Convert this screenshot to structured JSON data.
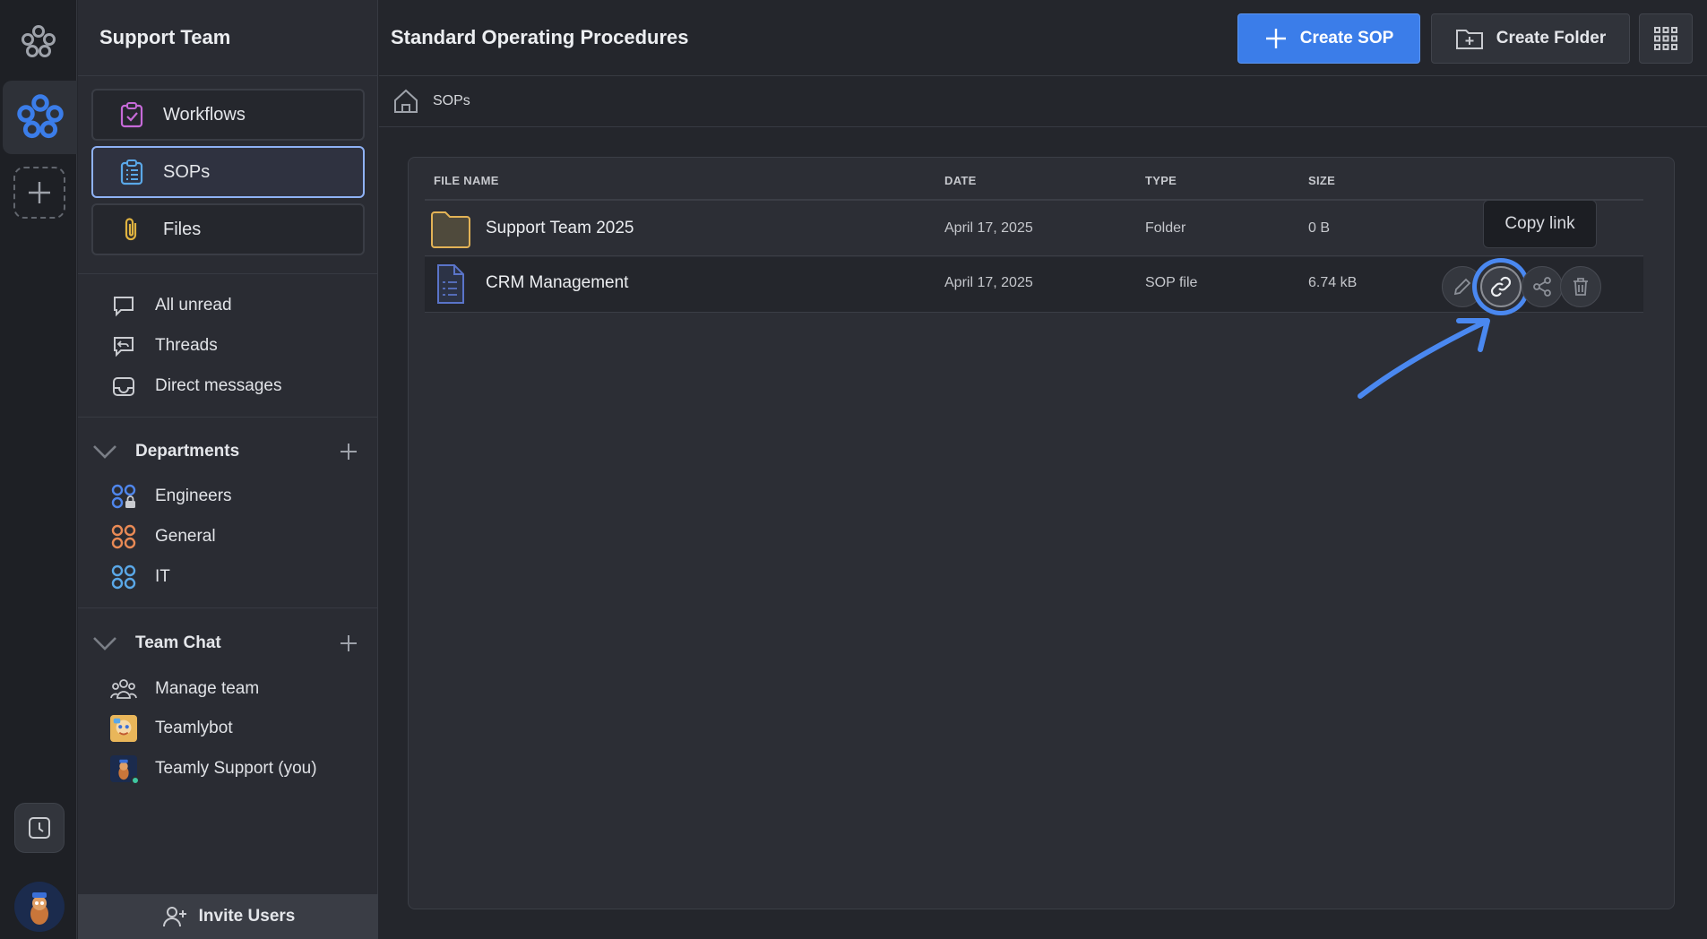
{
  "sidebar": {
    "title": "Support Team",
    "nav": [
      {
        "label": "Workflows",
        "icon": "workflow-clipboard-icon"
      },
      {
        "label": "SOPs",
        "icon": "sop-list-icon"
      },
      {
        "label": "Files",
        "icon": "paperclip-icon"
      }
    ],
    "inbox": [
      {
        "label": "All unread",
        "icon": "chat-bubble-icon"
      },
      {
        "label": "Threads",
        "icon": "thread-reply-icon"
      },
      {
        "label": "Direct messages",
        "icon": "inbox-tray-icon"
      }
    ],
    "departments": {
      "title": "Departments",
      "items": [
        {
          "label": "Engineers",
          "icon": "private-channel-icon"
        },
        {
          "label": "General",
          "icon": "channel-icon"
        },
        {
          "label": "IT",
          "icon": "channel-icon"
        }
      ]
    },
    "team_chat": {
      "title": "Team Chat",
      "items": [
        {
          "label": "Manage team",
          "icon": "team-icon"
        },
        {
          "label": "Teamlybot",
          "icon": "bot-avatar"
        },
        {
          "label": "Teamly Support (you)",
          "icon": "user-avatar"
        }
      ]
    },
    "invite_label": "Invite Users"
  },
  "header": {
    "title": "Standard Operating Procedures",
    "create_sop": "Create SOP",
    "create_folder": "Create Folder"
  },
  "breadcrumb": {
    "current": "SOPs"
  },
  "table": {
    "columns": [
      "FILE NAME",
      "DATE",
      "TYPE",
      "SIZE"
    ],
    "rows": [
      {
        "name": "Support Team 2025",
        "date": "April 17, 2025",
        "type": "Folder",
        "size": "0 B",
        "icon": "folder-icon"
      },
      {
        "name": "CRM Management",
        "date": "April 17, 2025",
        "type": "SOP file",
        "size": "6.74 kB",
        "icon": "sop-file-icon"
      }
    ]
  },
  "tooltip": "Copy link",
  "colors": {
    "accent": "#3b7de9",
    "annotation": "#4a88f0",
    "background": "#24262c"
  }
}
